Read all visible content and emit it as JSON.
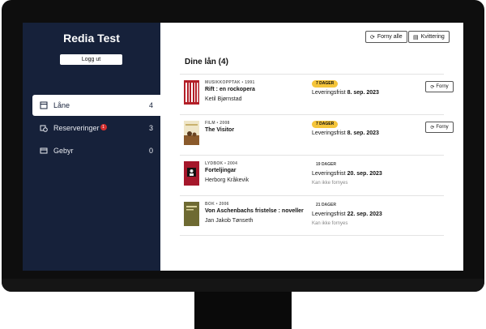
{
  "sidebar": {
    "title": "Redia Test",
    "logout_label": "Logg ut",
    "items": [
      {
        "label": "Låne",
        "count": "4"
      },
      {
        "label": "Reserveringer",
        "badge": "1",
        "count": "3"
      },
      {
        "label": "Gebyr",
        "count": "0"
      }
    ]
  },
  "toolbar": {
    "renew_all_label": "Forny alle",
    "receipt_label": "Kvittering"
  },
  "main": {
    "heading": "Dine lån (4)",
    "loans": [
      {
        "meta": "MUSIKKOPPTAK • 1991",
        "title": "Rift : en rockopera",
        "author": "Ketil Bjørnstad",
        "badge": "7 DAGER",
        "due_prefix": "Leveringsfrist",
        "due_date": "8. sep. 2023",
        "renew_label": "Forny"
      },
      {
        "meta": "FILM • 2008",
        "title": "The Visitor",
        "author": "",
        "badge": "7 DAGER",
        "due_prefix": "Leveringsfrist",
        "due_date": "8. sep. 2023",
        "renew_label": "Forny"
      },
      {
        "meta": "LYDBOK • 2004",
        "title": "Forteljingar",
        "author": "Herborg Kråkevik",
        "badge": "19 DAGER",
        "due_prefix": "Leveringsfrist",
        "due_date": "20. sep. 2023",
        "note": "Kan ikke fornyes"
      },
      {
        "meta": "BOK • 2006",
        "title": "Von Aschenbachs fristelse : noveller",
        "author": "Jan Jakob Tønseth",
        "badge": "21 DAGER",
        "due_prefix": "Leveringsfrist",
        "due_date": "22. sep. 2023",
        "note": "Kan ikke fornyes"
      }
    ]
  },
  "colors": {
    "sidebar_bg": "#16213a",
    "badge_yellow": "#f5c53a",
    "badge_red": "#d32f2f"
  },
  "icons": [
    "book-icon",
    "reservation-icon",
    "card-icon",
    "refresh-icon",
    "receipt-icon"
  ]
}
